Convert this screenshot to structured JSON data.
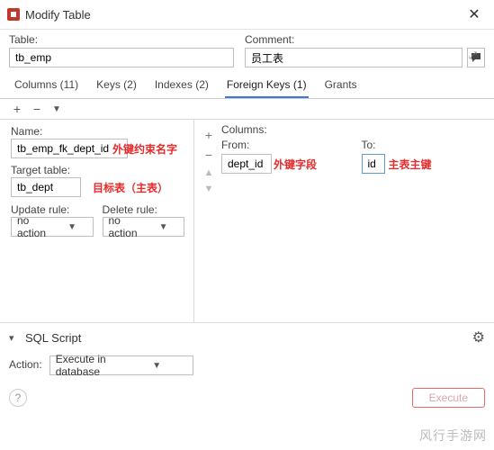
{
  "window": {
    "title": "Modify Table",
    "close": "✕"
  },
  "labels": {
    "table": "Table:",
    "comment": "Comment:",
    "name": "Name:",
    "target_table": "Target table:",
    "update_rule": "Update rule:",
    "delete_rule": "Delete rule:",
    "columns": "Columns:",
    "from": "From:",
    "to": "To:",
    "sql_script": "SQL Script",
    "action": "Action:"
  },
  "values": {
    "table": "tb_emp",
    "comment": "员工表",
    "fk_name": "tb_emp_fk_dept_id",
    "target_table": "tb_dept",
    "update_rule": "no action",
    "delete_rule": "no action",
    "from_col": "dept_id",
    "to_col": "id",
    "action_mode": "Execute in database",
    "execute_btn": "Execute"
  },
  "tabs": [
    {
      "label": "Columns (11)"
    },
    {
      "label": "Keys (2)"
    },
    {
      "label": "Indexes (2)"
    },
    {
      "label": "Foreign Keys (1)",
      "active": true
    },
    {
      "label": "Grants"
    }
  ],
  "annotations": {
    "fk_name": "外键约束名字",
    "target": "目标表（主表）",
    "from": "外键字段",
    "to": "主表主键"
  },
  "watermark": "风行手游网"
}
